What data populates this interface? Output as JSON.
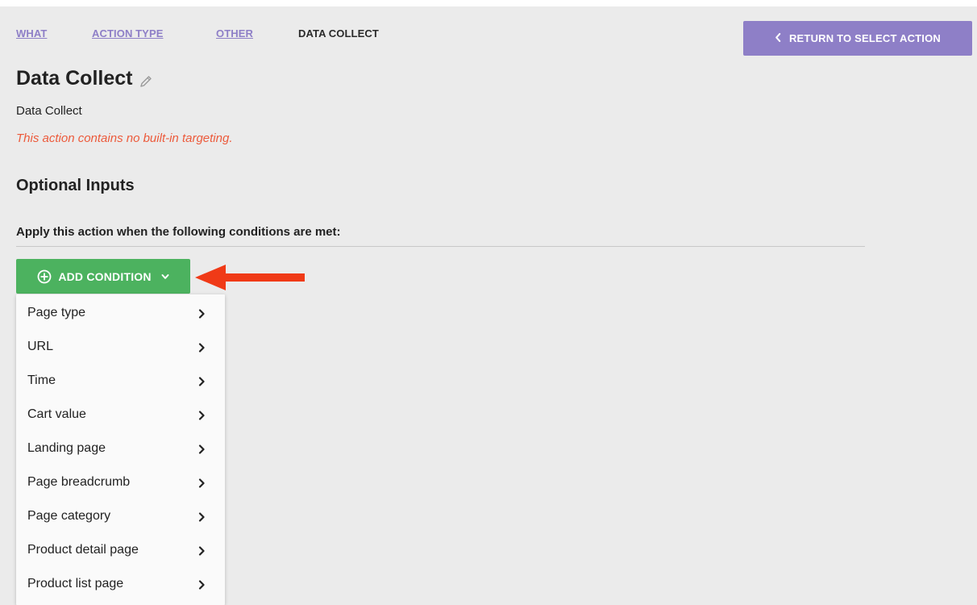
{
  "breadcrumb": {
    "items": [
      {
        "label": "WHAT",
        "link": true
      },
      {
        "label": "ACTION TYPE",
        "link": true
      },
      {
        "label": "OTHER",
        "link": true
      },
      {
        "label": "DATA COLLECT",
        "link": false
      }
    ]
  },
  "return_button": {
    "label": "RETURN TO SELECT ACTION",
    "icon": "chevron-left-icon"
  },
  "page": {
    "title": "Data Collect",
    "title_icon": "pencil-icon",
    "subtitle": "Data Collect",
    "warning": "This action contains no built-in targeting."
  },
  "optional_inputs": {
    "heading": "Optional Inputs",
    "condition_label": "Apply this action when the following conditions are met:"
  },
  "add_condition": {
    "label": "ADD CONDITION",
    "icon": "plus-circle-icon",
    "caret_icon": "chevron-down-icon"
  },
  "dropdown": {
    "items": [
      {
        "label": "Page type"
      },
      {
        "label": "URL"
      },
      {
        "label": "Time"
      },
      {
        "label": "Cart value"
      },
      {
        "label": "Landing page"
      },
      {
        "label": "Page breadcrumb"
      },
      {
        "label": "Page category"
      },
      {
        "label": "Product detail page"
      },
      {
        "label": "Product list page"
      }
    ],
    "item_icon": "chevron-right-icon"
  },
  "annotation": {
    "icon": "arrow-left-icon"
  },
  "colors": {
    "accent_purple": "#8e7fc7",
    "button_green": "#4cb25f",
    "warning_red": "#ec5a3b",
    "annotation_red": "#f03a17",
    "panel_bg": "#ebebeb"
  }
}
